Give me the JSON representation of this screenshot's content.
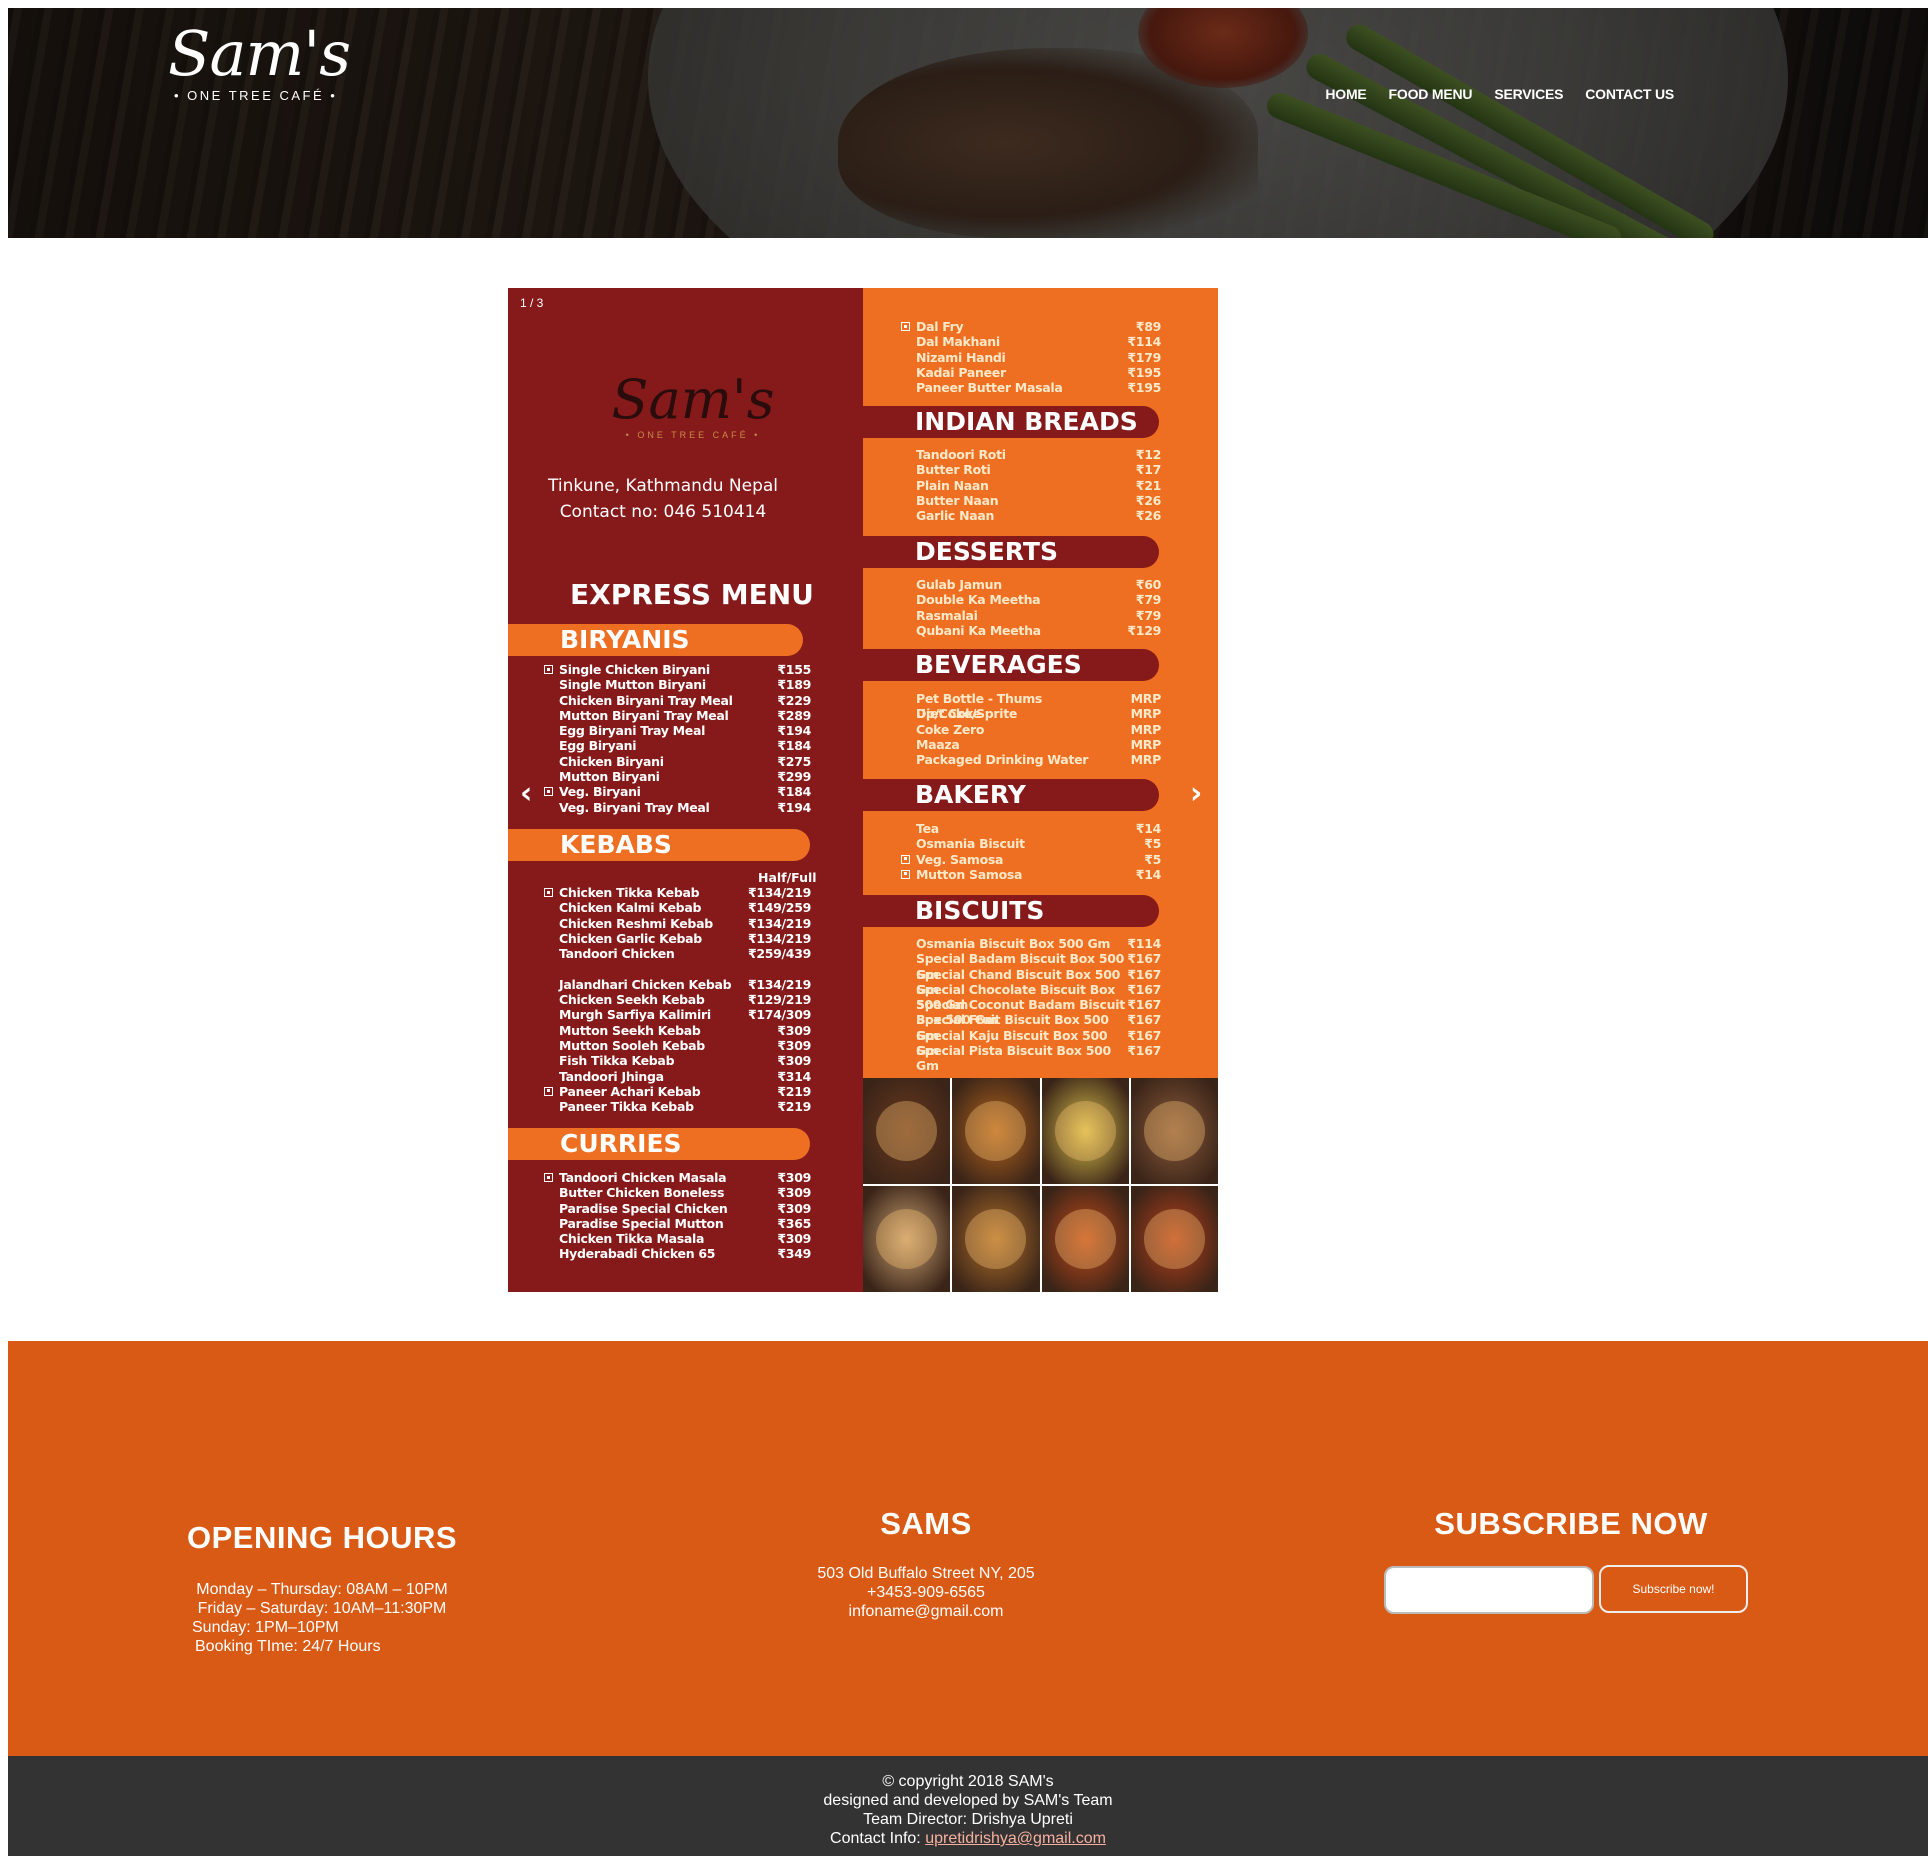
{
  "header": {
    "logo": {
      "name": "Sam's",
      "tagline": "• ONE TREE CAFÉ •"
    },
    "nav": [
      "HOME",
      "FOOD MENU",
      "SERVICES",
      "CONTACT US"
    ]
  },
  "menu": {
    "slide_counter": "1 / 3",
    "prev_arrow": "‹",
    "next_arrow": "›",
    "logo": {
      "name": "Sam's",
      "tagline": "• ONE TREE CAFÉ •"
    },
    "address": "Tinkune, Kathmandu Nepal",
    "contact": "Contact no: 046 510414",
    "heading": "EXPRESS MENU",
    "half_full": "Half/Full",
    "biryanis": {
      "title": "BIRYANIS",
      "items": [
        {
          "name": "Single Chicken Biryani",
          "price": "₹155",
          "veg": true
        },
        {
          "name": "Single Mutton Biryani",
          "price": "₹189"
        },
        {
          "name": "Chicken Biryani Tray Meal",
          "price": "₹229"
        },
        {
          "name": "Mutton Biryani Tray Meal",
          "price": "₹289"
        },
        {
          "name": "Egg Biryani Tray Meal",
          "price": "₹194"
        },
        {
          "name": "Egg Biryani",
          "price": "₹184"
        },
        {
          "name": "Chicken Biryani",
          "price": "₹275"
        },
        {
          "name": "Mutton Biryani",
          "price": "₹299"
        },
        {
          "name": "Veg. Biryani",
          "price": "₹184",
          "veg": true
        },
        {
          "name": "Veg. Biryani Tray Meal",
          "price": "₹194"
        }
      ]
    },
    "kebabs": {
      "title": "KEBABS",
      "items": [
        {
          "name": "Chicken Tikka Kebab",
          "price": "₹134/219",
          "veg": true
        },
        {
          "name": "Chicken Kalmi Kebab",
          "price": "₹149/259"
        },
        {
          "name": "Chicken Reshmi Kebab",
          "price": "₹134/219"
        },
        {
          "name": "Chicken Garlic Kebab",
          "price": "₹134/219"
        },
        {
          "name": "Tandoori Chicken",
          "price": "₹259/439"
        },
        {
          "name": "",
          "price": ""
        },
        {
          "name": "Jalandhari Chicken Kebab",
          "price": "₹134/219"
        },
        {
          "name": "Chicken Seekh Kebab",
          "price": "₹129/219"
        },
        {
          "name": "Murgh Sarfiya Kalimiri",
          "price": "₹174/309"
        },
        {
          "name": "Mutton Seekh Kebab",
          "price": "₹309"
        },
        {
          "name": "Mutton Sooleh Kebab",
          "price": "₹309"
        },
        {
          "name": "Fish Tikka Kebab",
          "price": "₹309"
        },
        {
          "name": "Tandoori Jhinga",
          "price": "₹314"
        },
        {
          "name": "Paneer Achari Kebab",
          "price": "₹219",
          "veg": true
        },
        {
          "name": "Paneer Tikka Kebab",
          "price": "₹219"
        }
      ]
    },
    "curries": {
      "title": "CURRIES",
      "items": [
        {
          "name": "Tandoori Chicken Masala",
          "price": "₹309",
          "veg": true
        },
        {
          "name": "Butter Chicken Boneless",
          "price": "₹309"
        },
        {
          "name": "Paradise Special Chicken",
          "price": "₹309"
        },
        {
          "name": "Paradise Special Mutton",
          "price": "₹365"
        },
        {
          "name": "Chicken Tikka Masala",
          "price": "₹309"
        },
        {
          "name": "Hyderabadi Chicken 65",
          "price": "₹349"
        }
      ]
    },
    "dal": {
      "items": [
        {
          "name": "Dal Fry",
          "price": "₹89",
          "veg": true
        },
        {
          "name": "Dal Makhani",
          "price": "₹114"
        },
        {
          "name": "Nizami Handi",
          "price": "₹179"
        },
        {
          "name": "Kadai Paneer",
          "price": "₹195"
        },
        {
          "name": "Paneer Butter Masala",
          "price": "₹195"
        }
      ]
    },
    "breads": {
      "title": "INDIAN BREADS",
      "items": [
        {
          "name": "Tandoori Roti",
          "price": "₹12"
        },
        {
          "name": "Butter Roti",
          "price": "₹17"
        },
        {
          "name": "Plain Naan",
          "price": "₹21"
        },
        {
          "name": "Butter Naan",
          "price": "₹26"
        },
        {
          "name": "Garlic Naan",
          "price": "₹26"
        }
      ]
    },
    "desserts": {
      "title": "DESSERTS",
      "items": [
        {
          "name": "Gulab Jamun",
          "price": "₹60"
        },
        {
          "name": "Double Ka Meetha",
          "price": "₹79"
        },
        {
          "name": "Rasmalai",
          "price": "₹79"
        },
        {
          "name": "Qubani Ka Meetha",
          "price": "₹129"
        }
      ]
    },
    "beverages": {
      "title": "BEVERAGES",
      "items": [
        {
          "name": "Pet Bottle - Thums Up/Coke/Sprite",
          "price": "MRP"
        },
        {
          "name": "Diet Coke",
          "price": "MRP"
        },
        {
          "name": "Coke Zero",
          "price": "MRP"
        },
        {
          "name": "Maaza",
          "price": "MRP"
        },
        {
          "name": "Packaged Drinking Water",
          "price": "MRP"
        }
      ]
    },
    "bakery": {
      "title": "BAKERY",
      "items": [
        {
          "name": "Tea",
          "price": "₹14"
        },
        {
          "name": "Osmania Biscuit",
          "price": "₹5"
        },
        {
          "name": "Veg. Samosa",
          "price": "₹5",
          "veg": true
        },
        {
          "name": "Mutton Samosa",
          "price": "₹14",
          "veg": true
        }
      ]
    },
    "biscuits": {
      "title": "BISCUITS",
      "items": [
        {
          "name": "Osmania Biscuit Box 500 Gm",
          "price": "₹114"
        },
        {
          "name": "Special Badam Biscuit Box 500 Gm",
          "price": "₹167"
        },
        {
          "name": "Special Chand Biscuit Box 500 Gm",
          "price": "₹167"
        },
        {
          "name": "Special Chocolate Biscuit Box 500 Gm",
          "price": "₹167"
        },
        {
          "name": "Special Coconut Badam Biscuit Box 500 Gm",
          "price": "₹167"
        },
        {
          "name": "Special Fruit Biscuit Box 500 Gm",
          "price": "₹167"
        },
        {
          "name": "Special Kaju Biscuit Box 500 Gm",
          "price": "₹167"
        },
        {
          "name": "Special Pista Biscuit Box 500 Gm",
          "price": "₹167"
        }
      ]
    },
    "photo_colors": [
      "#6b3a1e",
      "#b5651d",
      "#d8c04a",
      "#8a5a3a",
      "#c8a070",
      "#b0702a",
      "#c14a1a",
      "#b8401a"
    ]
  },
  "footer": {
    "hours": {
      "title": "OPENING HOURS",
      "lines": [
        "Monday – Thursday: 08AM – 10PM",
        "Friday – Saturday: 10AM–11:30PM",
        "Sunday: 1PM–10PM",
        "Booking TIme: 24/7 Hours"
      ]
    },
    "contact": {
      "title": "SAMS",
      "lines": [
        "503 Old Buffalo Street NY, 205",
        "+3453-909-6565",
        "infoname@gmail.com"
      ]
    },
    "subscribe": {
      "title": "SUBSCRIBE NOW",
      "input_value": "",
      "button": "Subscribe now!"
    }
  },
  "bottom": {
    "copyright": "© copyright 2018 SAM's",
    "designed": "designed and developed by SAM's Team",
    "director": "Team Director: Drishya Upreti",
    "contact_label": "Contact Info:",
    "contact_email": "upretidrishya@gmail.com"
  },
  "colors": {
    "menu_maroon": "#861a1a",
    "menu_orange": "#ef6f22",
    "footer_orange": "#d95a15",
    "bottom_dark": "#333333"
  }
}
